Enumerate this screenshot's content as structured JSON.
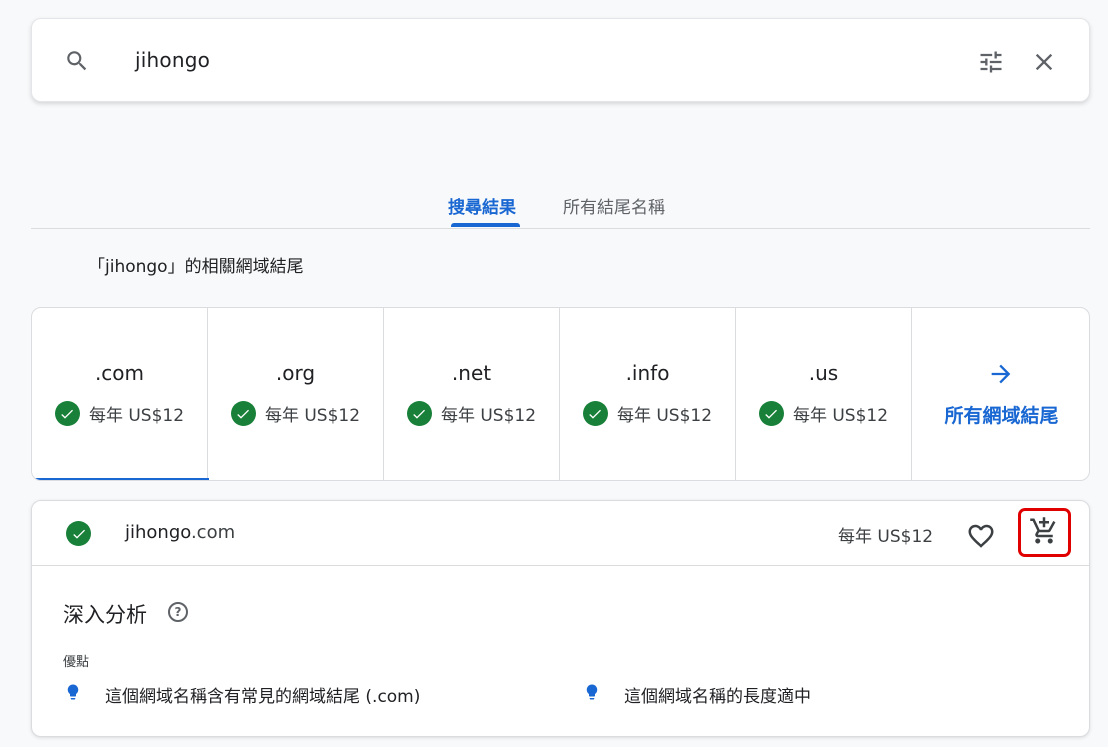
{
  "search": {
    "query": "jihongo"
  },
  "tabs": [
    {
      "label": "搜尋結果",
      "active": true
    },
    {
      "label": "所有結尾名稱",
      "active": false
    }
  ],
  "section_title": "「jihongo」的相關網域結尾",
  "tlds": [
    {
      "name": ".com",
      "price": "每年 US$12",
      "available": true,
      "selected": true
    },
    {
      "name": ".org",
      "price": "每年 US$12",
      "available": true
    },
    {
      "name": ".net",
      "price": "每年 US$12",
      "available": true
    },
    {
      "name": ".info",
      "price": "每年 US$12",
      "available": true
    },
    {
      "name": ".us",
      "price": "每年 US$12",
      "available": true
    }
  ],
  "all_tlds_label": "所有網域結尾",
  "result": {
    "domain_sld": "jihongo",
    "domain_tld": ".com",
    "price": "每年 US$12"
  },
  "insights": {
    "title": "深入分析",
    "help_glyph": "?",
    "pros_label": "優點",
    "pros": [
      "這個網域名稱含有常見的網域結尾 (.com)",
      "這個網域名稱的長度適中"
    ]
  },
  "colors": {
    "accent": "#1967d2",
    "available_green": "#188038",
    "cart_highlight": "#e00000"
  },
  "icons": [
    "search-icon",
    "tune-icon",
    "close-icon",
    "check-circle-icon",
    "arrow-right-icon",
    "heart-outline-icon",
    "add-cart-icon",
    "help-icon",
    "lightbulb-icon"
  ]
}
